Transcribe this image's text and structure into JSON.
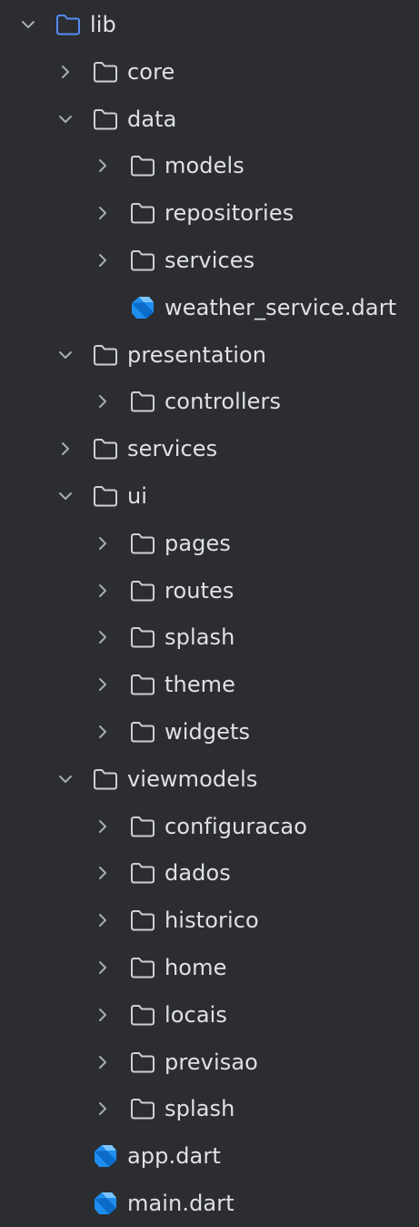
{
  "theme": {
    "background": "#2b2d30",
    "text": "#dfe1e5",
    "chevron": "#a8abb0",
    "folder_outline": "#ced0d6",
    "root_folder_outline": "#548af7",
    "dart_icon": "#1e8ff0"
  },
  "rows": [
    {
      "label": "lib",
      "depth": 0,
      "type": "folder",
      "chevron": "expanded",
      "root": true,
      "icon": "folder-icon"
    },
    {
      "label": "core",
      "depth": 1,
      "type": "folder",
      "chevron": "collapsed",
      "icon": "folder-icon"
    },
    {
      "label": "data",
      "depth": 1,
      "type": "folder",
      "chevron": "expanded",
      "icon": "folder-icon"
    },
    {
      "label": "models",
      "depth": 2,
      "type": "folder",
      "chevron": "collapsed",
      "icon": "folder-icon"
    },
    {
      "label": "repositories",
      "depth": 2,
      "type": "folder",
      "chevron": "collapsed",
      "icon": "folder-icon"
    },
    {
      "label": "services",
      "depth": 2,
      "type": "folder",
      "chevron": "collapsed",
      "icon": "folder-icon"
    },
    {
      "label": "weather_service.dart",
      "depth": 2,
      "type": "file",
      "chevron": "none",
      "icon": "dart-file-icon"
    },
    {
      "label": "presentation",
      "depth": 1,
      "type": "folder",
      "chevron": "expanded",
      "icon": "folder-icon"
    },
    {
      "label": "controllers",
      "depth": 2,
      "type": "folder",
      "chevron": "collapsed",
      "icon": "folder-icon"
    },
    {
      "label": "services",
      "depth": 1,
      "type": "folder",
      "chevron": "collapsed",
      "icon": "folder-icon"
    },
    {
      "label": "ui",
      "depth": 1,
      "type": "folder",
      "chevron": "expanded",
      "icon": "folder-icon"
    },
    {
      "label": "pages",
      "depth": 2,
      "type": "folder",
      "chevron": "collapsed",
      "icon": "folder-icon"
    },
    {
      "label": "routes",
      "depth": 2,
      "type": "folder",
      "chevron": "collapsed",
      "icon": "folder-icon"
    },
    {
      "label": "splash",
      "depth": 2,
      "type": "folder",
      "chevron": "collapsed",
      "icon": "folder-icon"
    },
    {
      "label": "theme",
      "depth": 2,
      "type": "folder",
      "chevron": "collapsed",
      "icon": "folder-icon"
    },
    {
      "label": "widgets",
      "depth": 2,
      "type": "folder",
      "chevron": "collapsed",
      "icon": "folder-icon"
    },
    {
      "label": "viewmodels",
      "depth": 1,
      "type": "folder",
      "chevron": "expanded",
      "icon": "folder-icon"
    },
    {
      "label": "configuracao",
      "depth": 2,
      "type": "folder",
      "chevron": "collapsed",
      "icon": "folder-icon"
    },
    {
      "label": "dados",
      "depth": 2,
      "type": "folder",
      "chevron": "collapsed",
      "icon": "folder-icon"
    },
    {
      "label": "historico",
      "depth": 2,
      "type": "folder",
      "chevron": "collapsed",
      "icon": "folder-icon"
    },
    {
      "label": "home",
      "depth": 2,
      "type": "folder",
      "chevron": "collapsed",
      "icon": "folder-icon"
    },
    {
      "label": "locais",
      "depth": 2,
      "type": "folder",
      "chevron": "collapsed",
      "icon": "folder-icon"
    },
    {
      "label": "previsao",
      "depth": 2,
      "type": "folder",
      "chevron": "collapsed",
      "icon": "folder-icon"
    },
    {
      "label": "splash",
      "depth": 2,
      "type": "folder",
      "chevron": "collapsed",
      "icon": "folder-icon"
    },
    {
      "label": "app.dart",
      "depth": 1,
      "type": "file",
      "chevron": "none",
      "icon": "dart-file-icon"
    },
    {
      "label": "main.dart",
      "depth": 1,
      "type": "file",
      "chevron": "none",
      "icon": "dart-file-icon"
    }
  ]
}
